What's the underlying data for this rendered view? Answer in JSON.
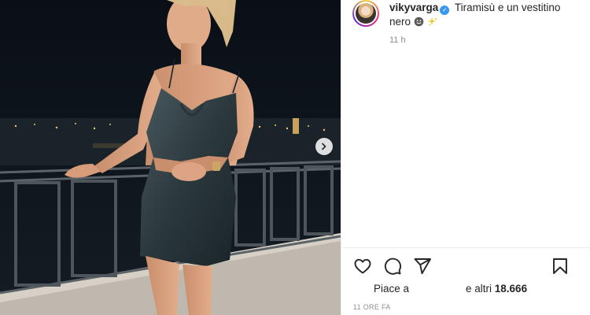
{
  "post": {
    "username": "vikyvarga",
    "caption": "Tiramisù e un vestitino nero",
    "caption_emojis": [
      "smiley-face-emoji",
      "sparkles-emoji"
    ],
    "timestamp_short": "11 h",
    "likes_prefix": "Piace a",
    "likes_and": "e altri",
    "likes_count": "18.666",
    "timestamp_full": "11 ORE FA"
  },
  "colors": {
    "verified_badge": "#3897f0",
    "muted_text": "#8e8e8e",
    "primary_text": "#262626",
    "photo_night_sky": "#0b1118"
  },
  "icons": [
    "heart-icon",
    "comment-icon",
    "share-icon",
    "bookmark-icon",
    "chevron-right-icon",
    "verified-icon"
  ]
}
